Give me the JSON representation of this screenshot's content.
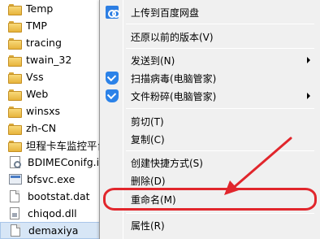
{
  "file_list": {
    "items": [
      {
        "name": "Temp",
        "type": "folder"
      },
      {
        "name": "TMP",
        "type": "folder"
      },
      {
        "name": "tracing",
        "type": "folder"
      },
      {
        "name": "twain_32",
        "type": "folder"
      },
      {
        "name": "Vss",
        "type": "folder"
      },
      {
        "name": "Web",
        "type": "folder"
      },
      {
        "name": "winsxs",
        "type": "folder"
      },
      {
        "name": "zh-CN",
        "type": "folder"
      },
      {
        "name": "坦程卡车监控平台",
        "type": "folder"
      },
      {
        "name": "BDIMEConifg.ini",
        "type": "ini"
      },
      {
        "name": "bfsvc.exe",
        "type": "exe"
      },
      {
        "name": "bootstat.dat",
        "type": "file"
      },
      {
        "name": "chiqod.dll",
        "type": "dll"
      },
      {
        "name": "demaxiya",
        "type": "file",
        "selected": true
      }
    ]
  },
  "context_menu": {
    "upload_baidu": "上传到百度网盘",
    "restore_version": "还原以前的版本(V)",
    "send_to": "发送到(N)",
    "scan_virus": "扫描病毒(电脑管家)",
    "shred_file": "文件粉碎(电脑管家)",
    "cut": "剪切(T)",
    "copy": "复制(C)",
    "create_shortcut": "创建快捷方式(S)",
    "delete": "删除(D)",
    "rename": "重命名(M)",
    "properties": "属性(R)"
  },
  "annotation": {
    "color": "#e1262c",
    "highlighted_item": "rename"
  },
  "icons": {
    "baidu": "baidu-cloud-icon",
    "pc_manager": "pc-manager-shield-icon",
    "folder": "folder-icon",
    "file": "file-icon"
  }
}
